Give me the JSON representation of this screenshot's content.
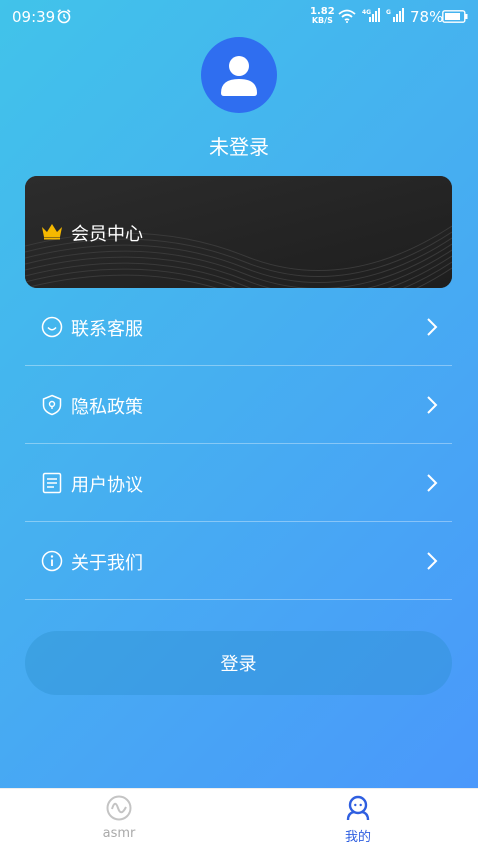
{
  "status_bar": {
    "time": "09:39",
    "net_speed_value": "1.82",
    "net_speed_unit": "KB/S",
    "signal1_label": "4G",
    "signal2_label": "G",
    "battery": "78%"
  },
  "profile": {
    "login_status": "未登录"
  },
  "vip": {
    "label": "会员中心",
    "crown_color": "#f5b800"
  },
  "menu": {
    "items": [
      {
        "label": "联系客服",
        "icon": "smile-icon"
      },
      {
        "label": "隐私政策",
        "icon": "shield-icon"
      },
      {
        "label": "用户协议",
        "icon": "document-icon"
      },
      {
        "label": "关于我们",
        "icon": "info-icon"
      }
    ]
  },
  "login_button": {
    "label": "登录"
  },
  "tab_bar": {
    "tabs": [
      {
        "label": "asmr",
        "icon": "wave-icon",
        "active": false
      },
      {
        "label": "我的",
        "icon": "user-icon",
        "active": true
      }
    ]
  },
  "colors": {
    "gradient_start": "#41c3ea",
    "gradient_end": "#4a98fb",
    "avatar_bg": "#2f6ef0",
    "active_tab": "#2f5fe0",
    "inactive_tab": "#aaaaaa"
  }
}
